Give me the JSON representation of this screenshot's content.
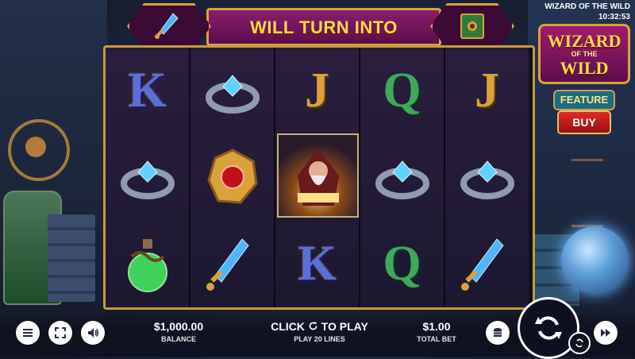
{
  "banner": {
    "text": "WILL TURN INTO",
    "left_symbol": "dagger-icon",
    "right_symbol": "spellbook-icon"
  },
  "header": {
    "game_name": "WIZARD OF THE WILD",
    "clock": "10:32:53"
  },
  "logo": {
    "line1": "WIZARD",
    "line2": "OF THE",
    "line3": "WILD"
  },
  "feature": {
    "label": "FEATURE",
    "buy_label": "BUY"
  },
  "reels": [
    [
      "letter-k",
      "ring-icon",
      "potion-icon"
    ],
    [
      "ring-icon",
      "amulet-icon",
      "dagger-icon"
    ],
    [
      "letter-j",
      "wizard-icon",
      "letter-k"
    ],
    [
      "letter-q",
      "ring-icon",
      "letter-q"
    ],
    [
      "letter-j",
      "ring-icon",
      "dagger-icon"
    ]
  ],
  "letters": {
    "k": "K",
    "j": "J",
    "q": "Q"
  },
  "controls": {
    "balance_value": "$1,000.00",
    "balance_label": "BALANCE",
    "play_prefix": "CLICK",
    "play_suffix": "TO PLAY",
    "play_lines": "PLAY 20 LINES",
    "bet_value": "$1.00",
    "bet_label": "TOTAL BET"
  },
  "colors": {
    "frame_gold": "#c79a3a",
    "banner_purple": "#8a1c6e",
    "buy_red": "#e02a2a",
    "feature_teal": "#1d6b86"
  }
}
